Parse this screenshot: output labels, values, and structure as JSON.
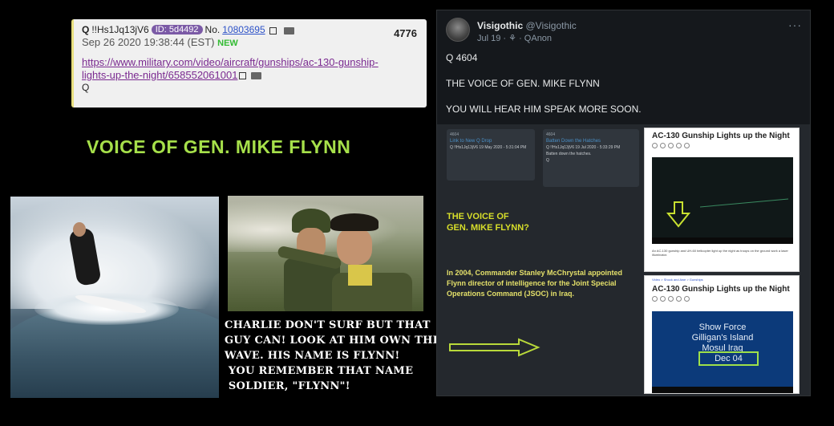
{
  "qpost": {
    "author": "Q",
    "trip": "!!Hs1Jq13jV6",
    "id_badge": "ID: 5d4492",
    "no_label": "No.",
    "post_number": "10803695",
    "count": "4776",
    "date": "Sep 26 2020 19:38:44 (EST)",
    "new_label": "NEW",
    "url_line1": "https://www.military.com/video/aircraft/gunships/ac-130-gunship-",
    "url_line2": "lights-up-the-night/658552061001",
    "signature": "Q"
  },
  "headline": "VOICE OF GEN. MIKE FLYNN",
  "caption": {
    "lines": [
      "CHARLIE DON'T SURF BUT THAT",
      "GUY CAN! LOOK AT HIM OWN THE",
      "WAVE. HIS NAME IS FLYNN!",
      " YOU REMEMBER THAT NAME",
      " SOLDIER, \"FLYNN\"!"
    ]
  },
  "tweet": {
    "name": "Visigothic",
    "handle": "@Visigothic",
    "date": "Jul 19",
    "community": "QAnon",
    "more": "···",
    "lines": [
      "Q 4604",
      "THE VOICE OF GEN. MIKE FLYNN",
      "YOU WILL HEAR HIM SPEAK MORE SOON."
    ],
    "image": {
      "card1": {
        "num": "4604",
        "title": "Link to New Q Drop",
        "sub": "Q !!Hs1Jq13jV6  19 May 2020 - 5:31:04 PM"
      },
      "card2": {
        "num": "4604",
        "title": "Batten Down the Hatches",
        "sub": "Q !!Hs1Jq13jV6  19 Jul 2020 - 5:33:29 PM",
        "body": "Batten down the hatches.",
        "sig": "Q"
      },
      "voice_line1": "THE VOICE OF",
      "voice_line2": "GEN. MIKE FLYNN?",
      "para": "In 2004, Commander Stanley McChrystal appointed Flynn director of intelligence for the Joint Special Operations Command (JSOC) in Iraq.",
      "article1_title": "AC-130 Gunship Lights up the Night",
      "article1_desc": "An AC-130 gunship and UH-60 helicopter light up the night as troops on the ground work a laser illuminator.",
      "article2_crumb": "Video > Shock and Awe > Gunships",
      "article2_title": "AC-130 Gunship Lights up the Night",
      "sf_line1": "Show Force",
      "sf_line2": "Gilligan's Island",
      "sf_line3": "Mosul Iraq",
      "sf_box": "Dec 04"
    }
  },
  "colors": {
    "headline": "#a6e04a",
    "id_badge": "#7b5aa6",
    "link": "#2d52c8",
    "new": "#33bb33"
  }
}
